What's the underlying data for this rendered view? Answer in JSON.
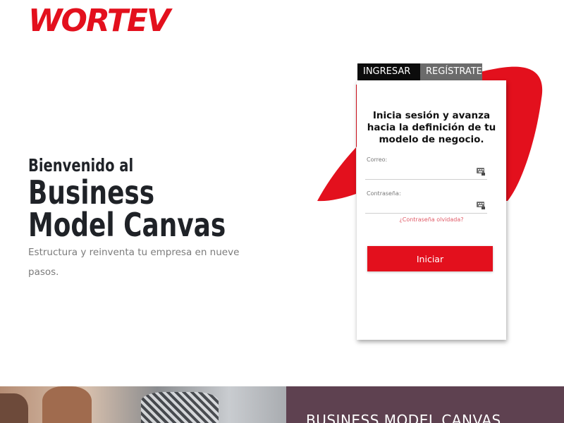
{
  "brand": {
    "name": "WORTEV",
    "accent": "#e3101d"
  },
  "hero": {
    "line1": "Bienvenido al",
    "line2": "Business",
    "line3": "Model Canvas",
    "description": "Estructura y reinventa tu empresa en nueve pasos."
  },
  "login": {
    "tabs": [
      {
        "label": "INGRESAR",
        "active": true
      },
      {
        "label": "REGÍSTRATE",
        "active": false
      }
    ],
    "title": "Inicia sesión y avanza hacia la definición de tu modelo de negocio.",
    "email_label": "Correo:",
    "email_value": "",
    "password_label": "Contraseña:",
    "password_value": "",
    "field_icon": "keyboard-icon",
    "forgot_label": "¿Contraseña olvidada?",
    "submit_label": "Iniciar"
  },
  "bottom": {
    "panel_title": "BUSINESS MODEL CANVAS",
    "panel_color": "#5e4150"
  }
}
